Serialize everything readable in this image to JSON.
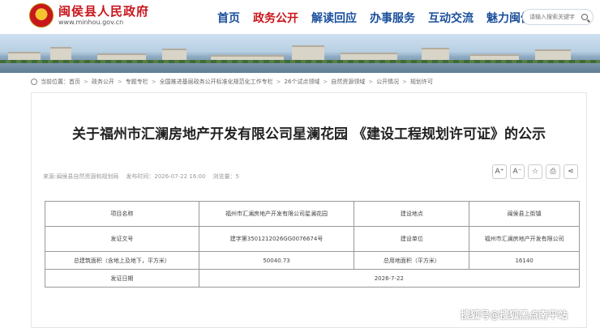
{
  "site": {
    "title": "闽侯县人民政府",
    "url": "www.minhou.gov.cn"
  },
  "nav": {
    "items": [
      "首页",
      "政务公开",
      "解读回应",
      "办事服务",
      "互动交流",
      "魅力闽侯"
    ],
    "active_index": 1
  },
  "search": {
    "placeholder": "请输入搜索关键字"
  },
  "breadcrumb": {
    "label": "当前位置：",
    "items": [
      "首页",
      "政务公开",
      "专题专栏",
      "全国推进基层政务公开标准化规范化工作专栏",
      "26个试点领域",
      "自然资源领域",
      "公开情况",
      "规划许可"
    ]
  },
  "article": {
    "title": "关于福州市汇澜房地产开发有限公司星澜花园 《建设工程规划许可证》的公示",
    "meta": {
      "source": "来源:闽侯县自然资源和规划局",
      "date": "发布时间：2026-07-22 16:00",
      "views": "浏览量：5"
    },
    "tools": [
      "A⁺",
      "A⁻",
      "☆",
      "⎙",
      "⋖"
    ],
    "table": {
      "row1": [
        "项目名称",
        "福州市汇澜房地产开发有限公司星澜花园",
        "建设地点",
        "闽侯县上街镇"
      ],
      "row2": [
        "发证文号",
        "建字第3501212026GG0076674号",
        "建设单位",
        "福州市汇澜房地产开发有限公司"
      ],
      "row3": [
        "总建筑面积（含地上及地下，平方米）",
        "50040.73",
        "总用地面积（平方米）",
        "16140"
      ],
      "row4": [
        "发证日期",
        "2026-7-22"
      ]
    }
  },
  "watermark": "搜狐号@搜狐黑点南平站",
  "colors": {
    "brand_red": "#c8161d",
    "nav_blue": "#1a4f9c"
  }
}
